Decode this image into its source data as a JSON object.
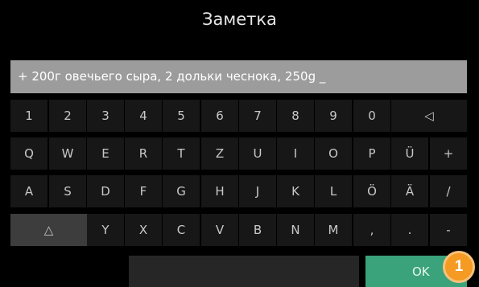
{
  "title": "Заметка",
  "input": {
    "value": "+ 200г овечьего сыра, 2 дольки чеснока, 250g _"
  },
  "keyboard": {
    "row1": [
      "1",
      "2",
      "3",
      "4",
      "5",
      "6",
      "7",
      "8",
      "9",
      "0",
      "◁"
    ],
    "row2": [
      "Q",
      "W",
      "E",
      "R",
      "T",
      "Z",
      "U",
      "I",
      "O",
      "P",
      "Ü",
      "+"
    ],
    "row3": [
      "A",
      "S",
      "D",
      "F",
      "G",
      "H",
      "J",
      "K",
      "L",
      "Ö",
      "Ä",
      "/"
    ],
    "row4": [
      "△",
      "Y",
      "X",
      "C",
      "V",
      "B",
      "N",
      "M",
      ",",
      ".",
      "-"
    ],
    "ok_label": "OK"
  },
  "badge": "1",
  "colors": {
    "ok": "#3aa37c",
    "badge": "#f59a23",
    "key": "#171717",
    "input": "#9c9c9c"
  }
}
